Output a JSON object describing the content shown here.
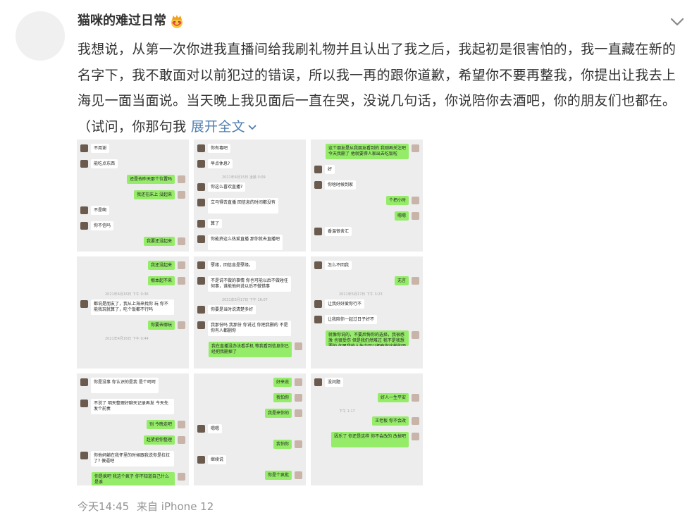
{
  "post": {
    "username": "猫咪的难过日常",
    "badge_icon": "crown-emoji-icon",
    "text": "我想说，从第一次你进我直播间给我刷礼物并且认出了我之后，我起初是很害怕的，我一直藏在新的名字下，我不敢面对以前犯过的错误，所以我一再的跟你道歉，希望你不要再整我，你提出让我去上海见一面当面说。当天晚上我见面后一直在哭，没说几句话，你说陪你去酒吧，你的朋友们也都在。（试问，你那句我",
    "expand_label": "展开全文",
    "time": "今天14:45",
    "source": "来自 iPhone 12"
  },
  "images": [
    {
      "label": "chat-screenshot-1",
      "timestamps": [],
      "bubbles": [
        {
          "side": "l",
          "text": "不用谢"
        },
        {
          "side": "l",
          "text": "能吃点东西"
        },
        {
          "side": "r",
          "text": "还是去昨天那个位置吗"
        },
        {
          "side": "r",
          "text": "我还在床上 没起来"
        },
        {
          "side": "l",
          "text": "不是啊"
        },
        {
          "side": "l",
          "text": "你不信吗"
        },
        {
          "side": "r",
          "text": "我要还没起来"
        }
      ]
    },
    {
      "label": "chat-screenshot-2",
      "timestamps": [
        "2021年4月15日 凌晨 0:09"
      ],
      "bubbles": [
        {
          "side": "l",
          "text": "你有毒吧"
        },
        {
          "side": "l",
          "text": "早点休息?"
        },
        {
          "side": "l",
          "text": "你这么喜欢直播?"
        },
        {
          "side": "l",
          "text": "立马得去直播 回信息的时间都没有",
          "tall": true
        },
        {
          "side": "l",
          "text": "算了"
        },
        {
          "side": "l",
          "text": "你能挤这么热爱直播 那你就去直播吧",
          "tall": true
        }
      ]
    },
    {
      "label": "chat-screenshot-3",
      "timestamps": [],
      "bubbles": [
        {
          "side": "r",
          "text": "这个朋友是从我朋友看到的 我刚再关注吧 今天我删了 他就要得人家出去吃饭啦",
          "tall": true
        },
        {
          "side": "l",
          "text": "好"
        },
        {
          "side": "l",
          "text": "你啥时候到家"
        },
        {
          "side": "r",
          "text": "个把小时"
        },
        {
          "side": "r",
          "text": "嗯嗯"
        },
        {
          "side": "l",
          "text": "香温很舍汇"
        }
      ]
    },
    {
      "label": "chat-screenshot-4",
      "timestamps": [
        "2021年4月16日 下午 0:36",
        "2021年4月16日 下午 0:44"
      ],
      "bubbles": [
        {
          "side": "r",
          "text": "我还没起来"
        },
        {
          "side": "r",
          "text": "根本起不来"
        },
        {
          "side": "l",
          "text": "都说是朋友了，我从上海来找你 玩 你不能我玩就算了，吃个饭都不行吗",
          "tall": true
        },
        {
          "side": "r",
          "text": "你要去哪玩"
        }
      ]
    },
    {
      "label": "chat-screenshot-5",
      "timestamps": [
        "2021年5月17日 下午 16:07"
      ],
      "bubbles": [
        {
          "side": "l",
          "text": "孽缘，回信息是孽缘。"
        },
        {
          "side": "l",
          "text": "不是说不做的事情 你也可能以后不做碰任何事，谁能他妈说以后不做错事",
          "tall": true
        },
        {
          "side": "l",
          "text": "你要是当时说清楚多好"
        },
        {
          "side": "l",
          "text": "我那份吗 我那份 你说过 你把我删的 不是你有人都删你",
          "tall": true
        },
        {
          "side": "r",
          "text": "我在直播没办法看手机 等我看到信息你已经把我删掉了",
          "tall": true
        }
      ]
    },
    {
      "label": "chat-screenshot-6",
      "timestamps": [
        "2021年5月17日 下午 3:23"
      ],
      "bubbles": [
        {
          "side": "l",
          "text": "怎么不回我"
        },
        {
          "side": "r",
          "text": "无言"
        },
        {
          "side": "l",
          "text": "让我好好爱你行不"
        },
        {
          "side": "l",
          "text": "让我陪你一起过日子好不"
        },
        {
          "side": "r",
          "text": "就像你说的，不要后悔你的选择，我很感激 也很受伤 但是我仍然难过 我不是我想要的 如果我的人生中可以拥有你这样的朋友",
          "tall": true
        }
      ]
    },
    {
      "label": "chat-screenshot-7",
      "timestamps": [],
      "bubbles": [
        {
          "side": "l",
          "text": "你是没事 你认识的是我 是个呵呵",
          "tall": true
        },
        {
          "side": "l",
          "text": "不说了 明天整理好聊天记录再发 今天先发个前奏",
          "tall": true
        },
        {
          "side": "r",
          "text": "别 今晚走吧"
        },
        {
          "side": "r",
          "text": "赶紧把你整理"
        },
        {
          "side": "l",
          "text": "你他妈躺在我怀里的时候跟我说你是拉拉了? 傻逼吧",
          "tall": true
        },
        {
          "side": "r",
          "text": "你是疯吧 我这个疯子 你不知道自己什么是谁",
          "tall": true
        }
      ]
    },
    {
      "label": "chat-screenshot-8",
      "timestamps": [],
      "bubbles": [
        {
          "side": "r",
          "text": "好来说"
        },
        {
          "side": "r",
          "text": "我怕你"
        },
        {
          "side": "r",
          "text": "我是来你的"
        },
        {
          "side": "l",
          "text": "嗯嗯"
        },
        {
          "side": "r",
          "text": "我怕你"
        },
        {
          "side": "l",
          "text": "继续说"
        },
        {
          "side": "r",
          "text": "你是个疯批"
        }
      ]
    },
    {
      "label": "chat-screenshot-9",
      "timestamps": [
        "下午 1:17"
      ],
      "bubbles": [
        {
          "side": "l",
          "text": "没问题"
        },
        {
          "side": "r",
          "text": "好人一生平安"
        },
        {
          "side": "r",
          "text": "王老板 你不会改"
        },
        {
          "side": "r",
          "text": "因乐了 你还是这样 你不会改的 改掉吧",
          "tall": true
        }
      ]
    }
  ],
  "colors": {
    "link": "#507daf",
    "meta": "#939393",
    "text": "#333333",
    "bubble_self": "#95ec69",
    "chat_bg": "#ededed"
  }
}
